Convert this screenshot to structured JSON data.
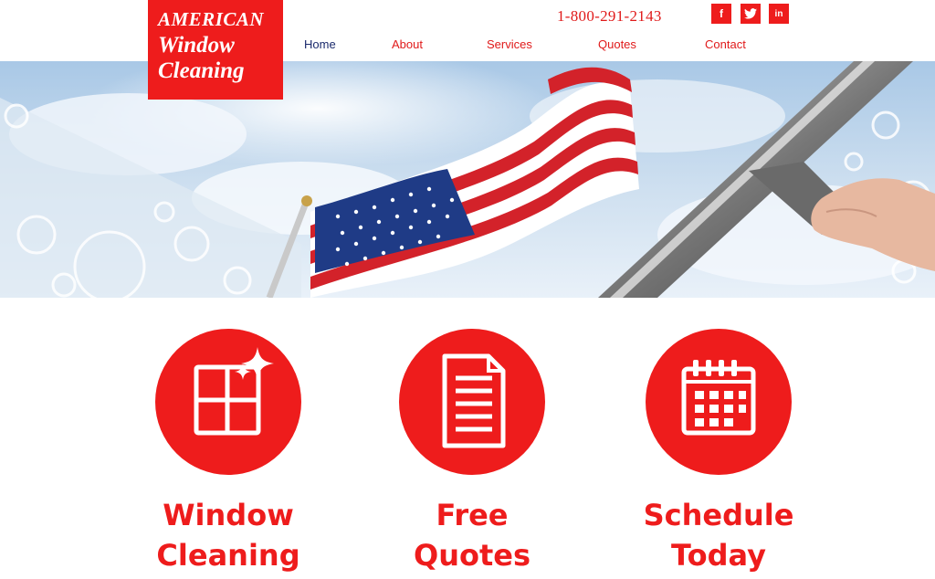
{
  "brand": {
    "line1": "AMERICAN",
    "line2": "Window",
    "line3": "Cleaning"
  },
  "header": {
    "phone": "1-800-291-2143",
    "social": {
      "facebook": "f",
      "twitter": "t",
      "linkedin": "in"
    }
  },
  "nav": {
    "items": [
      {
        "label": "Home",
        "active": true
      },
      {
        "label": "About"
      },
      {
        "label": "Services"
      },
      {
        "label": "Quotes"
      },
      {
        "label": "Contact"
      }
    ]
  },
  "features": [
    {
      "title_line1": "Window",
      "title_line2": "Cleaning",
      "icon": "window-sparkle-icon"
    },
    {
      "title_line1": "Free",
      "title_line2": "Quotes",
      "icon": "document-icon"
    },
    {
      "title_line1": "Schedule",
      "title_line2": "Today",
      "icon": "calendar-icon"
    }
  ],
  "colors": {
    "accent": "#ee1c1c",
    "nav_active": "#1a2a6c"
  }
}
